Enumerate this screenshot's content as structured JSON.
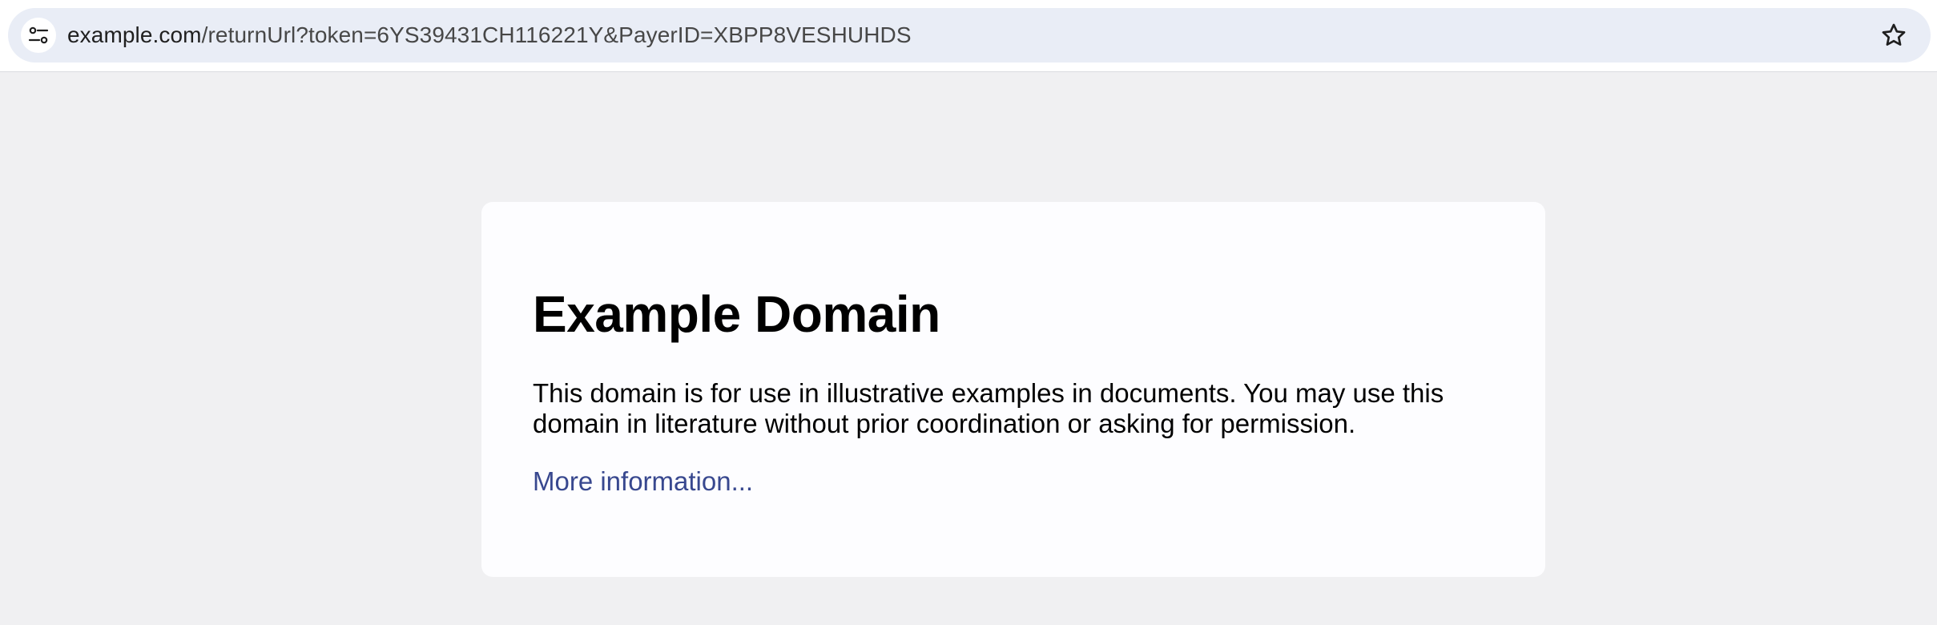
{
  "browser": {
    "url_host": "example.com",
    "url_rest": "/returnUrl?token=6YS39431CH116221Y&PayerID=XBPP8VESHUHDS",
    "site_info_icon": "tune-icon",
    "bookmark_icon": "star-outline-icon"
  },
  "page": {
    "heading": "Example Domain",
    "description": "This domain is for use in illustrative examples in documents. You may use this domain in literature without prior coordination or asking for permission.",
    "link_text": "More information..."
  },
  "colors": {
    "page_background": "#f0f0f2",
    "card_background": "#fdfdff",
    "link": "#38488f",
    "omnibox": "#e9edf6"
  }
}
